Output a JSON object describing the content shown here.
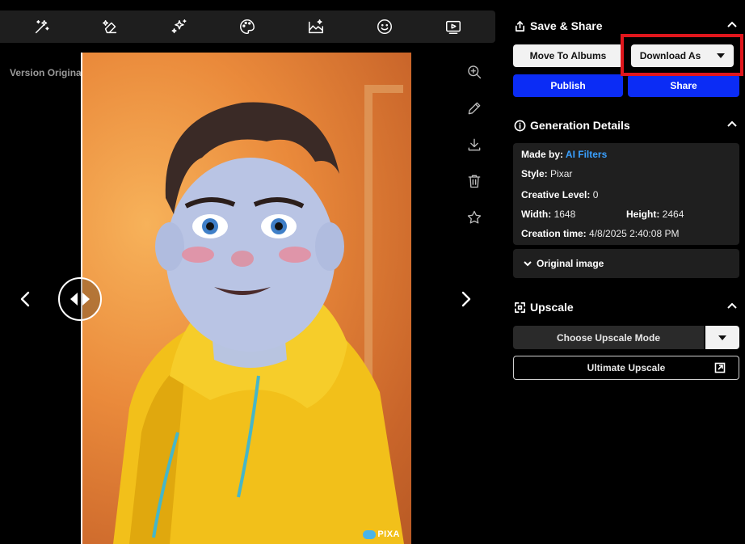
{
  "toolbar": {
    "tools": [
      "magic-wand-icon",
      "eraser-icon",
      "sparkles-icon",
      "palette-icon",
      "image-edit-icon",
      "smiley-icon",
      "video-icon"
    ]
  },
  "version": {
    "label": "Version Original"
  },
  "image": {
    "watermark": "PIXA"
  },
  "side_tools": [
    "zoom-in-icon",
    "pencil-icon",
    "download-icon",
    "trash-icon",
    "star-icon"
  ],
  "save_share": {
    "title": "Save & Share",
    "move_to_albums": "Move To Albums",
    "download_as": "Download As",
    "publish": "Publish",
    "share": "Share"
  },
  "generation": {
    "title": "Generation Details",
    "made_by_label": "Made by:",
    "made_by_value": "AI Filters",
    "style_label": "Style:",
    "style_value": "Pixar",
    "creative_label": "Creative Level:",
    "creative_value": "0",
    "width_label": "Width:",
    "width_value": "1648",
    "height_label": "Height:",
    "height_value": "2464",
    "creation_label": "Creation time:",
    "creation_value": "4/8/2025 2:40:08 PM",
    "original_image": "Original image"
  },
  "upscale": {
    "title": "Upscale",
    "mode": "Choose Upscale Mode",
    "ultimate": "Ultimate Upscale"
  },
  "colors": {
    "accent_blue": "#0b2cf5",
    "highlight_red": "#e0161c",
    "link_blue": "#3aa0ff"
  }
}
